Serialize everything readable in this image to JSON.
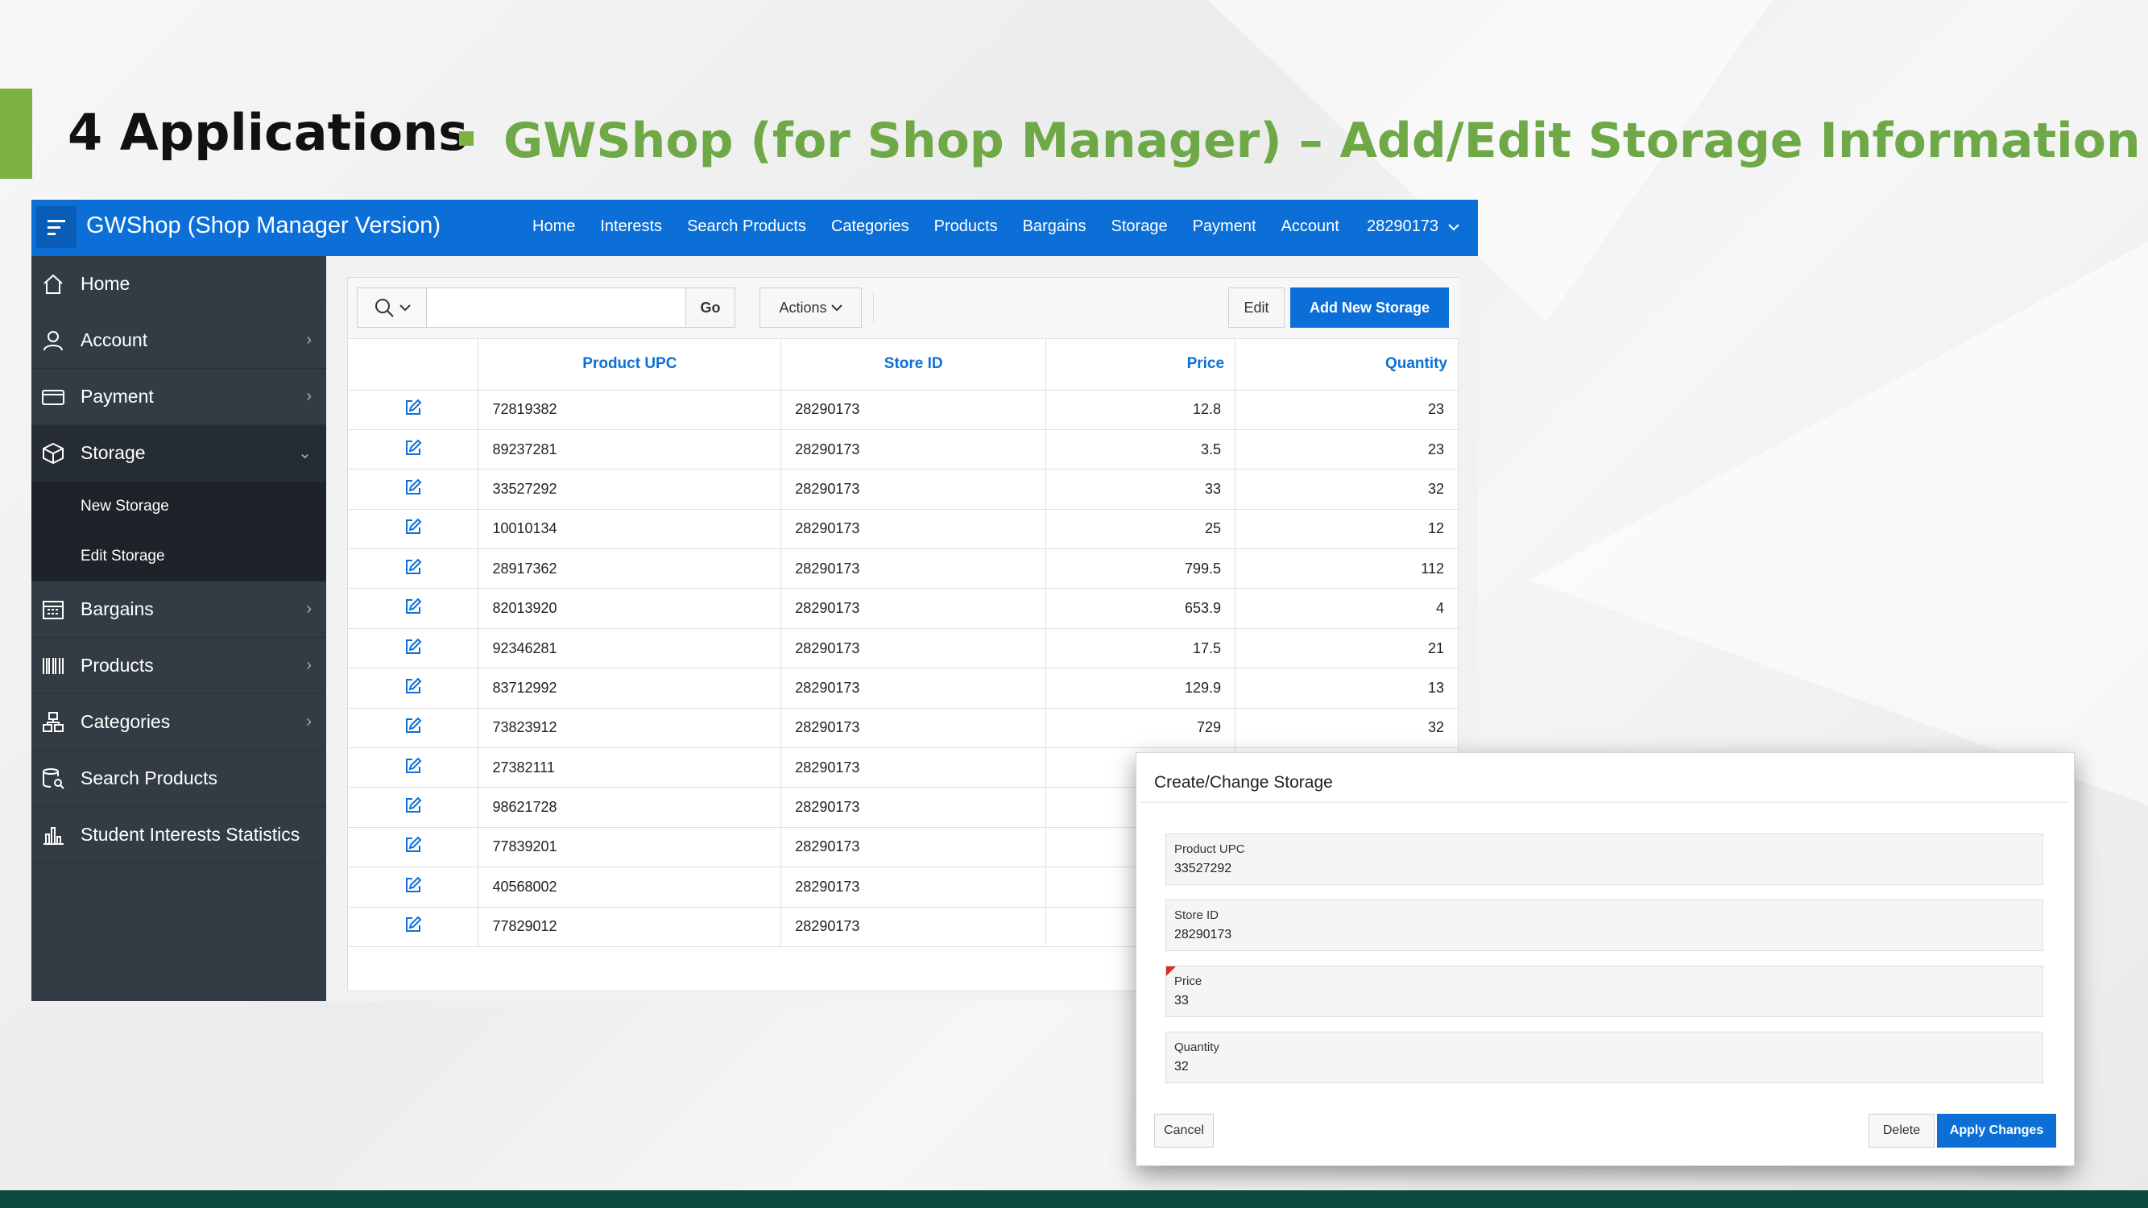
{
  "slide": {
    "title": "4 Applications",
    "subtitle": "GWShop (for Shop Manager) – Add/Edit Storage Information",
    "accent_color": "#7bb241"
  },
  "app": {
    "title": "GWShop (Shop Manager Version)",
    "brand_color": "#0c6fd8",
    "topnav": [
      "Home",
      "Interests",
      "Search Products",
      "Categories",
      "Products",
      "Bargains",
      "Storage",
      "Payment",
      "Account"
    ],
    "user": "28290173"
  },
  "sidebar": {
    "items": [
      {
        "label": "Home",
        "icon": "home-icon",
        "expandable": false
      },
      {
        "label": "Account",
        "icon": "user-icon",
        "expandable": true
      },
      {
        "label": "Payment",
        "icon": "credit-card-icon",
        "expandable": true
      },
      {
        "label": "Storage",
        "icon": "box-icon",
        "expandable": true,
        "expanded": true
      },
      {
        "label": "Bargains",
        "icon": "calendar-icon",
        "expandable": true
      },
      {
        "label": "Products",
        "icon": "barcode-icon",
        "expandable": true
      },
      {
        "label": "Categories",
        "icon": "hierarchy-icon",
        "expandable": true
      },
      {
        "label": "Search Products",
        "icon": "database-search-icon",
        "expandable": false
      },
      {
        "label": "Student Interests Statistics",
        "icon": "bar-chart-icon",
        "expandable": false
      }
    ],
    "storage_sub": [
      "New Storage",
      "Edit Storage"
    ]
  },
  "toolbar": {
    "go_label": "Go",
    "actions_label": "Actions",
    "edit_label": "Edit",
    "add_label": "Add New Storage"
  },
  "table": {
    "columns": [
      "Product UPC",
      "Store ID",
      "Price",
      "Quantity"
    ],
    "rows": [
      [
        "72819382",
        "28290173",
        "12.8",
        "23"
      ],
      [
        "89237281",
        "28290173",
        "3.5",
        "23"
      ],
      [
        "33527292",
        "28290173",
        "33",
        "32"
      ],
      [
        "10010134",
        "28290173",
        "25",
        "12"
      ],
      [
        "28917362",
        "28290173",
        "799.5",
        "112"
      ],
      [
        "82013920",
        "28290173",
        "653.9",
        "4"
      ],
      [
        "92346281",
        "28290173",
        "17.5",
        "21"
      ],
      [
        "83712992",
        "28290173",
        "129.9",
        "13"
      ],
      [
        "73823912",
        "28290173",
        "729",
        "32"
      ],
      [
        "27382111",
        "28290173",
        "",
        ""
      ],
      [
        "98621728",
        "28290173",
        "",
        ""
      ],
      [
        "77839201",
        "28290173",
        "",
        ""
      ],
      [
        "40568002",
        "28290173",
        "",
        ""
      ],
      [
        "77829012",
        "28290173",
        "",
        ""
      ]
    ]
  },
  "dialog": {
    "title": "Create/Change Storage",
    "fields": [
      {
        "label": "Product UPC",
        "value": "33527292"
      },
      {
        "label": "Store ID",
        "value": "28290173"
      },
      {
        "label": "Price",
        "value": "33",
        "required": true
      },
      {
        "label": "Quantity",
        "value": "32"
      }
    ],
    "cancel_label": "Cancel",
    "delete_label": "Delete",
    "apply_label": "Apply Changes"
  }
}
